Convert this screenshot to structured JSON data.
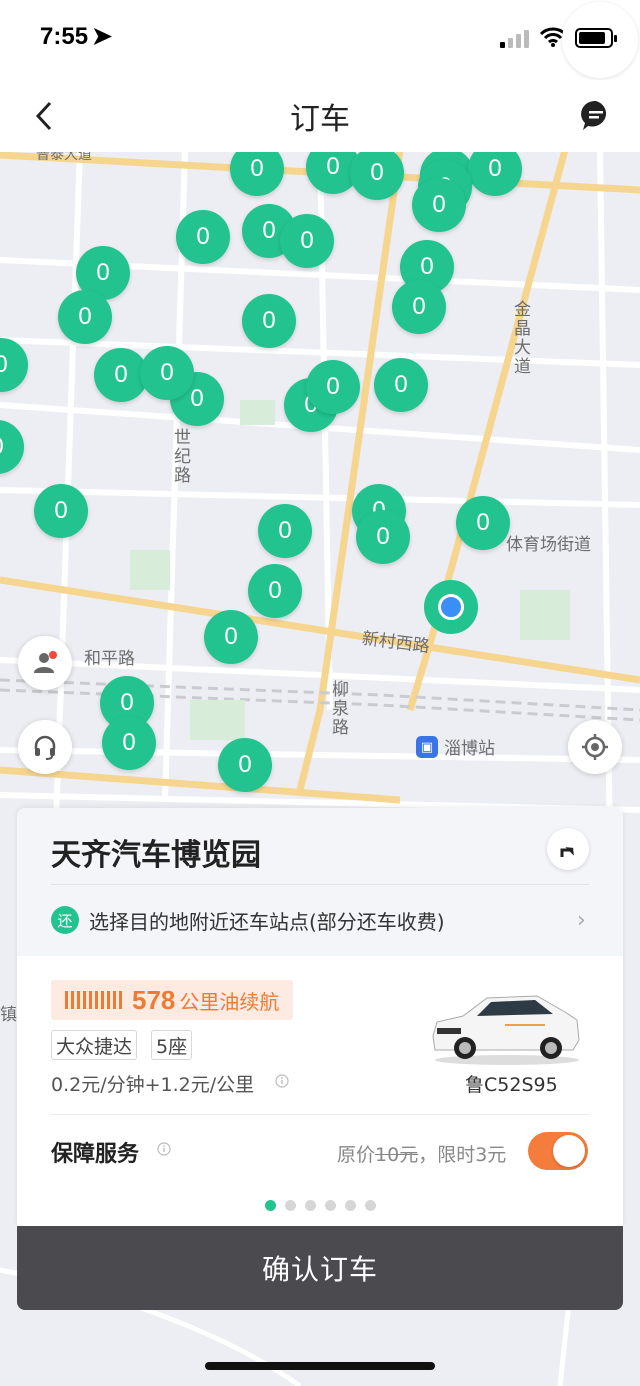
{
  "status_bar": {
    "time": "7:55"
  },
  "nav": {
    "title": "订车"
  },
  "map": {
    "station_count_label": "0",
    "labels": {
      "road_top": "普泰大道",
      "road_jinjing": "金晶大道",
      "road_shiji": "世纪路",
      "street_tiyuchang": "体育场街道",
      "road_xincun": "新村西路",
      "road_heping": "和平路",
      "road_liuquan": "柳泉路",
      "station_zibo": "淄博站",
      "edge_zhen": "镇"
    }
  },
  "card": {
    "place_name": "天齐汽车博览园",
    "return_badge": "还",
    "return_tip": "选择目的地附近还车站点(部分还车收费)",
    "range_value": "578",
    "range_text": "公里油续航",
    "car_model": "大众捷达",
    "seats": "5座",
    "price": "0.2元/分钟+1.2元/公里",
    "plate": "鲁C52S95",
    "insurance_label": "保障服务",
    "insurance_price_prefix": "原价",
    "insurance_orig": "10元",
    "insurance_now": "，限时3元",
    "insurance_enabled": true,
    "carousel_pages": 6,
    "carousel_active": 1
  },
  "confirm_button": "确认订车",
  "colors": {
    "accent": "#22c38e",
    "orange": "#f07a32",
    "button_dark": "#4b4a4f",
    "location_blue": "#3a8ef6"
  }
}
